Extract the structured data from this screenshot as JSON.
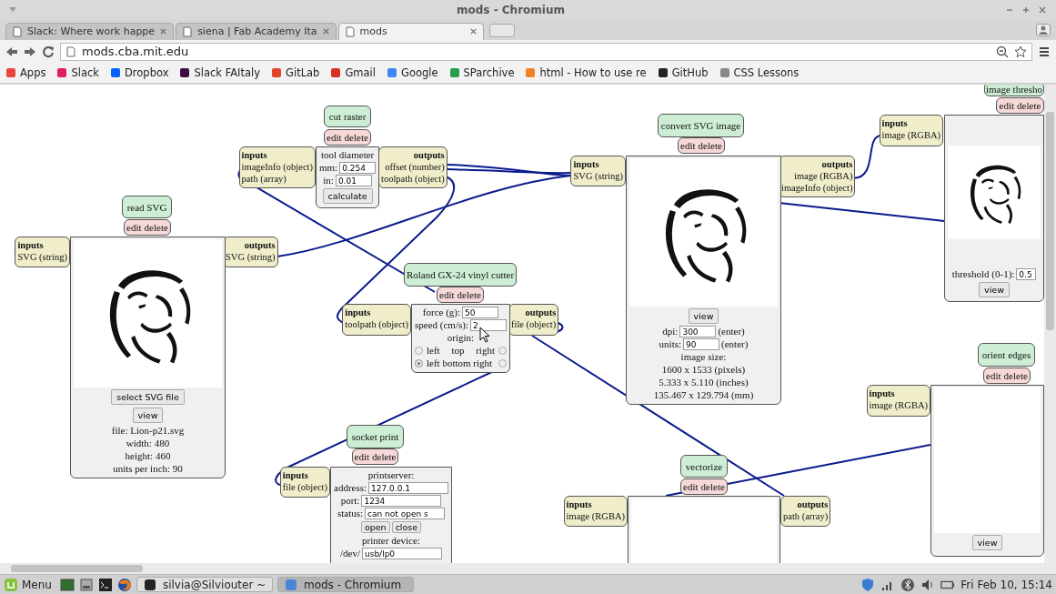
{
  "window": {
    "title": "mods - Chromium"
  },
  "tabs": [
    {
      "label": "Slack: Where work happe",
      "selected": false
    },
    {
      "label": "siena | Fab Academy Ita",
      "selected": false
    },
    {
      "label": "mods",
      "selected": true
    }
  ],
  "address": "mods.cba.mit.edu",
  "bookmarks": [
    {
      "label": "Apps",
      "color": "#e8453c"
    },
    {
      "label": "Slack",
      "color": "#e01e5a"
    },
    {
      "label": "Dropbox",
      "color": "#0061ff"
    },
    {
      "label": "Slack FAItaly",
      "color": "#3f0e40"
    },
    {
      "label": "GitLab",
      "color": "#e24329"
    },
    {
      "label": "Gmail",
      "color": "#d93025"
    },
    {
      "label": "Google",
      "color": "#4285f4"
    },
    {
      "label": "SParchive",
      "color": "#2a9d4a"
    },
    {
      "label": "html - How to use re",
      "color": "#f48024"
    },
    {
      "label": "GitHub",
      "color": "#222222"
    },
    {
      "label": "CSS Lessons",
      "color": "#888888"
    }
  ],
  "modules": [
    {
      "title": "image thresho",
      "actions": [
        "edit",
        "delete"
      ],
      "inputs": {
        "heading": "inputs",
        "ports": [
          "image (RGBA)"
        ]
      },
      "body": [
        {
          "kind": "picture"
        },
        {
          "kind": "field",
          "label": "threshold (0-1):",
          "value": "0.5"
        },
        {
          "kind": "button",
          "label": "view"
        }
      ]
    },
    {
      "title": "cut raster",
      "actions": [
        "edit",
        "delete"
      ],
      "inputs": {
        "heading": "inputs",
        "ports": [
          "imageInfo (object)",
          "path (array)"
        ]
      },
      "body": [
        {
          "kind": "text",
          "text": "tool diameter"
        },
        {
          "kind": "field",
          "label": "mm:",
          "value": "0.254"
        },
        {
          "kind": "field",
          "label": "in:",
          "value": "0.01"
        },
        {
          "kind": "button",
          "label": "calculate"
        }
      ],
      "outputs": {
        "heading": "outputs",
        "ports": [
          "offset (number)",
          "toolpath (object)"
        ]
      }
    },
    {
      "title": "read SVG",
      "actions": [
        "edit",
        "delete"
      ],
      "inputs": {
        "heading": "inputs",
        "ports": [
          "SVG (string)"
        ]
      },
      "body": [
        {
          "kind": "picture"
        },
        {
          "kind": "button",
          "label": "select SVG file"
        },
        {
          "kind": "button",
          "label": "view"
        },
        {
          "kind": "text",
          "text": "file: Lion-p21.svg"
        },
        {
          "kind": "text",
          "text": "width: 480"
        },
        {
          "kind": "text",
          "text": "height: 460"
        },
        {
          "kind": "text",
          "text": "units per inch: 90"
        }
      ],
      "outputs": {
        "heading": "outputs",
        "ports": [
          "SVG (string)"
        ]
      }
    },
    {
      "title": "convert SVG image",
      "actions": [
        "edit",
        "delete"
      ],
      "inputs": {
        "heading": "inputs",
        "ports": [
          "SVG (string)"
        ]
      },
      "body": [
        {
          "kind": "picture"
        },
        {
          "kind": "button",
          "label": "view"
        },
        {
          "kind": "field",
          "label": "dpi:",
          "value": "300",
          "suffix": "(enter)"
        },
        {
          "kind": "field",
          "label": "units:",
          "value": "90",
          "suffix": "(enter)"
        },
        {
          "kind": "text",
          "text": "image size:"
        },
        {
          "kind": "text",
          "text": "1600 x 1533 (pixels)"
        },
        {
          "kind": "text",
          "text": "5.333 x 5.110 (inches)"
        },
        {
          "kind": "text",
          "text": "135.467 x 129.794 (mm)"
        }
      ],
      "outputs": {
        "heading": "outputs",
        "ports": [
          "image (RGBA)",
          "imageInfo (object)"
        ]
      }
    },
    {
      "title": "Roland GX-24 vinyl cutter",
      "actions": [
        "edit",
        "delete"
      ],
      "inputs": {
        "heading": "inputs",
        "ports": [
          "toolpath (object)"
        ]
      },
      "body": [
        {
          "kind": "field",
          "label": "force (g):",
          "value": "50"
        },
        {
          "kind": "field",
          "label": "speed (cm/s):",
          "value": "2"
        },
        {
          "kind": "text",
          "text": "origin:"
        },
        {
          "kind": "radios",
          "rows": [
            {
              "words": [
                "left",
                "top",
                "right"
              ],
              "radios": [
                {
                  "selected": false
                },
                {
                  "selected": false
                }
              ]
            },
            {
              "words": [
                "left bottom right"
              ],
              "radios": [
                {
                  "selected": true
                },
                {
                  "selected": false
                }
              ]
            }
          ]
        }
      ],
      "outputs": {
        "heading": "outputs",
        "ports": [
          "file (object)"
        ]
      }
    },
    {
      "title": "socket print",
      "actions": [
        "edit",
        "delete"
      ],
      "inputs": {
        "heading": "inputs",
        "ports": [
          "file (object)"
        ]
      },
      "body": [
        {
          "kind": "text",
          "text": "printserver:"
        },
        {
          "kind": "field",
          "label": "address:",
          "value": "127.0.0.1"
        },
        {
          "kind": "field",
          "label": "port:",
          "value": "1234"
        },
        {
          "kind": "field",
          "label": "status:",
          "value": "can not open s"
        },
        {
          "kind": "buttons",
          "labels": [
            "open",
            "close"
          ]
        },
        {
          "kind": "text",
          "text": "printer device:"
        },
        {
          "kind": "field",
          "label": "/dev/",
          "value": "usb/lp0"
        }
      ]
    },
    {
      "title": "vectorize",
      "actions": [
        "edit",
        "delete"
      ],
      "inputs": {
        "heading": "inputs",
        "ports": [
          "image (RGBA)"
        ]
      },
      "body": [
        {
          "kind": "blank"
        }
      ],
      "outputs": {
        "heading": "outputs",
        "ports": [
          "path (array)"
        ]
      }
    },
    {
      "title": "orient edges",
      "actions": [
        "edit",
        "delete"
      ],
      "inputs": {
        "heading": "inputs",
        "ports": [
          "image (RGBA)"
        ]
      },
      "body": [
        {
          "kind": "blank"
        },
        {
          "kind": "button",
          "label": "view"
        }
      ]
    }
  ],
  "taskbar": {
    "menu": "Menu",
    "tasks": [
      {
        "label": "silvia@Silviouter ~",
        "selected": false
      },
      {
        "label": "mods - Chromium",
        "selected": true
      }
    ],
    "clock": "Fri Feb 10, 15:14"
  }
}
